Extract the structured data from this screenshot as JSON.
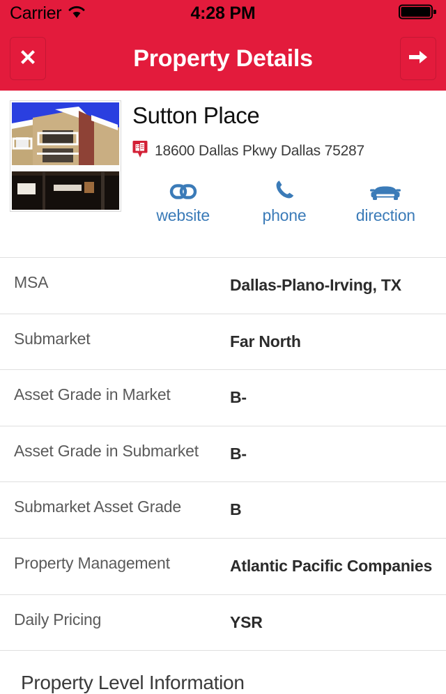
{
  "statusbar": {
    "carrier": "Carrier",
    "wifi_icon": "wifi-icon",
    "time": "4:28 PM",
    "battery_icon": "battery-full-icon"
  },
  "navbar": {
    "close_icon": "close-icon",
    "close_label": "✕",
    "title": "Property Details",
    "forward_icon": "arrow-right-icon"
  },
  "property": {
    "photo_alt": "property-photo",
    "name": "Sutton Place",
    "address_pin_icon": "map-pin-building-icon",
    "address": "18600 Dallas Pkwy Dallas 75287",
    "actions": [
      {
        "icon": "link-icon",
        "label": "website"
      },
      {
        "icon": "phone-icon",
        "label": "phone"
      },
      {
        "icon": "car-icon",
        "label": "direction"
      }
    ]
  },
  "details": [
    {
      "label": "MSA",
      "value": "Dallas-Plano-Irving, TX"
    },
    {
      "label": "Submarket",
      "value": "Far North"
    },
    {
      "label": "Asset Grade in Market",
      "value": "B-"
    },
    {
      "label": "Asset Grade in Submarket",
      "value": "B-"
    },
    {
      "label": "Submarket Asset Grade",
      "value": "B"
    },
    {
      "label": "Property Management",
      "value": "Atlantic Pacific Companies"
    },
    {
      "label": "Daily Pricing",
      "value": "YSR"
    }
  ],
  "section": {
    "property_level_information": "Property Level Information"
  },
  "colors": {
    "header_red": "#e31b3c",
    "link_blue": "#3b7bb8",
    "pin_red": "#d32036",
    "separator": "#dfdfdf",
    "label_gray": "#5a5a5a",
    "value_dark": "#2b2b2b"
  }
}
